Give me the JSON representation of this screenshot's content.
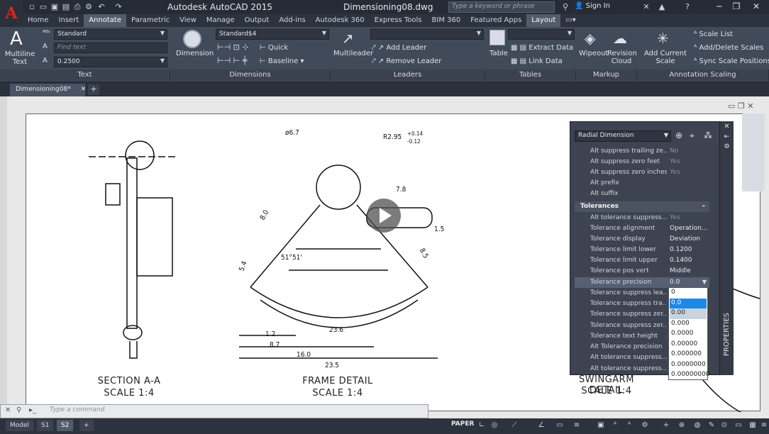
{
  "app_title": "Autodesk AutoCAD 2015",
  "doc_title": "Dimensioning08.dwg",
  "search_placeholder": "Type a keyword or phrase",
  "sign_in": "Sign In",
  "ribbon_tabs": [
    "Home",
    "Insert",
    "Annotate",
    "Parametric",
    "View",
    "Manage",
    "Output",
    "Add-ins",
    "Autodesk 360",
    "Express Tools",
    "BIM 360",
    "Featured Apps",
    "Layout"
  ],
  "active_tab": "Annotate",
  "text_panel": {
    "multiline_text": "Multiline Text",
    "style": "Standard",
    "find_text": "Find text",
    "height": "0.2500",
    "panel": "Text"
  },
  "dim_panel": {
    "dimension": "Dimension",
    "style": "Standard$4",
    "quick": "Quick",
    "baseline": "Baseline",
    "panel": "Dimensions"
  },
  "leader_panel": {
    "multileader": "Multileader",
    "add_leader": "Add Leader",
    "remove_leader": "Remove Leader",
    "panel": "Leaders"
  },
  "table_panel": {
    "table": "Table",
    "extract_data": "Extract Data",
    "link_data": "Link Data",
    "panel": "Tables"
  },
  "markup_panel": {
    "wipeout": "Wipeout",
    "revision_cloud": "Revision Cloud",
    "panel": "Markup"
  },
  "scale_panel": {
    "add_current_scale": "Add Current Scale",
    "scale_list": "Scale List",
    "add_delete_scales": "Add/Delete Scales",
    "sync_scale": "Sync Scale Positions",
    "panel": "Annotation Scaling"
  },
  "file_tab": "Dimensioning08*",
  "drawing": {
    "section_title": "SECTION A-A",
    "section_scale": "SCALE 1:4",
    "frame_title": "FRAME DETAIL",
    "frame_scale": "SCALE 1:4",
    "swingarm_title": "SWINGARM DETAIL",
    "swingarm_scale": "SCALE 1:4",
    "dims": {
      "d1": "ø6.7",
      "d2": "R2.95",
      "d2a": "+0.14",
      "d2b": "-0.12",
      "d3": "7.8",
      "d4": "1.5",
      "d5": "8.0",
      "d6": "5.4",
      "d7": "8.5",
      "d8": "51°51'",
      "d9": "1.2",
      "d10": "8.7",
      "d11": "23.6",
      "d12": "16.0",
      "d13": "23.5"
    }
  },
  "properties": {
    "object": "Radial Dimension",
    "rows_top": [
      {
        "k": "Alt suppress trailing ze...",
        "v": "No"
      },
      {
        "k": "Alt suppress zero feet",
        "v": "Yes"
      },
      {
        "k": "Alt suppress zero inches",
        "v": "Yes"
      },
      {
        "k": "Alt prefix",
        "v": ""
      },
      {
        "k": "Alt suffix",
        "v": ""
      }
    ],
    "section": "Tolerances",
    "rows": [
      {
        "k": "Alt tolerance suppress...",
        "v": "Yes"
      },
      {
        "k": "Tolerance alignment",
        "v": "Operation..."
      },
      {
        "k": "Tolerance display",
        "v": "Deviation"
      },
      {
        "k": "Tolerance limit lower",
        "v": "0.1200"
      },
      {
        "k": "Tolerance limit upper",
        "v": "0.1400"
      },
      {
        "k": "Tolerance pos vert",
        "v": "Middle"
      },
      {
        "k": "Tolerance precision",
        "v": "0.0"
      },
      {
        "k": "Tolerance suppress lea...",
        "v": ""
      },
      {
        "k": "Tolerance suppress tra...",
        "v": ""
      },
      {
        "k": "Tolerance suppress zer...",
        "v": ""
      },
      {
        "k": "Tolerance suppress zer...",
        "v": ""
      },
      {
        "k": "Tolerance text height",
        "v": ""
      },
      {
        "k": "Alt Tolerance precision",
        "v": ""
      },
      {
        "k": "Alt tolerance suppress...",
        "v": ""
      },
      {
        "k": "Alt tolerance suppress...",
        "v": ""
      }
    ],
    "dropdown": [
      "0",
      "0.0",
      "0.00",
      "0.000",
      "0.0000",
      "0.00000",
      "0.000000",
      "0.0000000",
      "0.00000000"
    ],
    "side_label": "PROPERTIES"
  },
  "command_placeholder": "Type a command",
  "layout_tabs": [
    "Model",
    "S1",
    "S2"
  ],
  "active_layout": "S2",
  "paper": "PAPER"
}
